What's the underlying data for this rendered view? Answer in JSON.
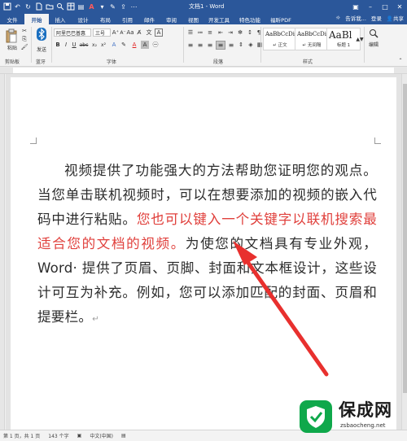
{
  "window": {
    "title": "文档1 - Word"
  },
  "tabs": [
    "文件",
    "开始",
    "插入",
    "设计",
    "布局",
    "引用",
    "邮件",
    "审阅",
    "视图",
    "开发工具",
    "特色功能",
    "福昕PDF"
  ],
  "active_tab": "开始",
  "tabs_right": {
    "search": "告诉我...",
    "login": "登录",
    "share": "共享"
  },
  "ribbon": {
    "paste": "粘贴",
    "send": "发送",
    "clipboard_label": "剪贴板",
    "bluetooth_label": "蓝牙",
    "font_name": "阿里巴巴普惠",
    "font_size": "三号",
    "font_group_label": "字体",
    "paragraph_group_label": "段落",
    "styles_group_label": "样式",
    "editing_label": "编辑",
    "styles": [
      {
        "sample": "AaBbCcDi",
        "name": "↵ 正文"
      },
      {
        "sample": "AaBbCcDi",
        "name": "↵ 无间隔"
      },
      {
        "sample": "AaBl",
        "name": "标题 1"
      }
    ]
  },
  "document": {
    "part1": "视频提供了功能强大的方法帮助您证明您的观点。当您单击联机视频时，可以在想要添加的视频的嵌入代码中进行粘贴。",
    "part_red": "您也可以键入一个关键字以联机搜索最适合您的文档的视频。",
    "part2": "为使您的文档具有专业外观，Word· 提供了页眉、页脚、封面和文本框设计，这些设计可互为补充。例如，您可以添加匹配的封面、页眉和提要栏。",
    "para_mark": "↵"
  },
  "status": {
    "page": "第 1 页，共 1 页",
    "words": "143 个字",
    "language": "中文(中国)"
  },
  "watermark": {
    "title": "保成网",
    "url": "zsbaocheng.net"
  },
  "colors": {
    "accent": "#2b579a",
    "highlight_red": "#e0403c",
    "arrow": "#e8302e"
  }
}
